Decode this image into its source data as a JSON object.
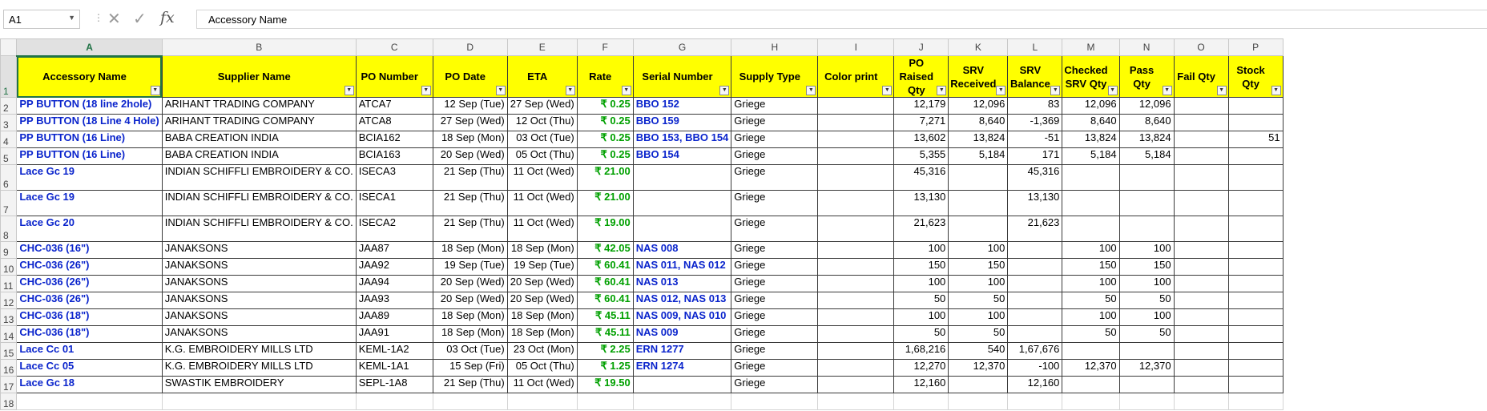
{
  "formula_bar": {
    "name_box": "A1",
    "formula": "Accessory Name",
    "cancel_icon": "✕",
    "enter_icon": "✓",
    "fx_icon": "fx"
  },
  "columns": [
    "A",
    "B",
    "C",
    "D",
    "E",
    "F",
    "G",
    "H",
    "I",
    "J",
    "K",
    "L",
    "M",
    "N",
    "O",
    "P"
  ],
  "header_row": [
    "Accessory Name",
    "Supplier Name",
    "PO Number",
    "PO Date",
    "ETA",
    "Rate",
    "Serial Number",
    "Supply Type",
    "Color print",
    "PO Raised Qty",
    "SRV Received",
    "SRV Balance",
    "Checked SRV Qty",
    "Pass Qty",
    "Fail Qty",
    "Stock Qty"
  ],
  "rows": [
    {
      "n": "2",
      "c": [
        "PP BUTTON (18 line 2hole)",
        "ARIHANT TRADING COMPANY",
        "ATCA7",
        "12 Sep (Tue)",
        "27 Sep (Wed)",
        "₹ 0.25",
        "BBO 152",
        "Griege",
        "",
        "12,179",
        "12,096",
        "83",
        "12,096",
        "12,096",
        "",
        ""
      ]
    },
    {
      "n": "3",
      "c": [
        "PP BUTTON (18 Line 4 Hole)",
        "ARIHANT TRADING COMPANY",
        "ATCA8",
        "27 Sep (Wed)",
        "12 Oct (Thu)",
        "₹ 0.25",
        "BBO 159",
        "Griege",
        "",
        "7,271",
        "8,640",
        "-1,369",
        "8,640",
        "8,640",
        "",
        ""
      ]
    },
    {
      "n": "4",
      "c": [
        "PP BUTTON (16 Line)",
        "BABA CREATION INDIA",
        "BCIA162",
        "18 Sep (Mon)",
        "03 Oct (Tue)",
        "₹ 0.25",
        "BBO 153, BBO 154",
        "Griege",
        "",
        "13,602",
        "13,824",
        "-51",
        "13,824",
        "13,824",
        "",
        "51"
      ]
    },
    {
      "n": "5",
      "c": [
        "PP BUTTON (16 Line)",
        "BABA CREATION INDIA",
        "BCIA163",
        "20 Sep (Wed)",
        "05 Oct (Thu)",
        "₹ 0.25",
        "BBO 154",
        "Griege",
        "",
        "5,355",
        "5,184",
        "171",
        "5,184",
        "5,184",
        "",
        ""
      ]
    },
    {
      "n": "6",
      "tall": true,
      "c": [
        "Lace Gc 19",
        "INDIAN SCHIFFLI EMBROIDERY & CO.",
        "ISECA3",
        "21 Sep (Thu)",
        "11 Oct (Wed)",
        "₹ 21.00",
        "",
        "Griege",
        "",
        "45,316",
        "",
        "45,316",
        "",
        "",
        "",
        ""
      ]
    },
    {
      "n": "7",
      "tall": true,
      "c": [
        "Lace Gc 19",
        "INDIAN SCHIFFLI EMBROIDERY & CO.",
        "ISECA1",
        "21 Sep (Thu)",
        "11 Oct (Wed)",
        "₹ 21.00",
        "",
        "Griege",
        "",
        "13,130",
        "",
        "13,130",
        "",
        "",
        "",
        ""
      ]
    },
    {
      "n": "8",
      "tall": true,
      "c": [
        "Lace Gc 20",
        "INDIAN SCHIFFLI EMBROIDERY & CO.",
        "ISECA2",
        "21 Sep (Thu)",
        "11 Oct (Wed)",
        "₹ 19.00",
        "",
        "Griege",
        "",
        "21,623",
        "",
        "21,623",
        "",
        "",
        "",
        ""
      ]
    },
    {
      "n": "9",
      "c": [
        "CHC-036 (16\")",
        "JANAKSONS",
        "JAA87",
        "18 Sep (Mon)",
        "18 Sep (Mon)",
        "₹ 42.05",
        "NAS 008",
        "Griege",
        "",
        "100",
        "100",
        "",
        "100",
        "100",
        "",
        ""
      ]
    },
    {
      "n": "10",
      "c": [
        "CHC-036 (26\")",
        "JANAKSONS",
        "JAA92",
        "19 Sep (Tue)",
        "19 Sep (Tue)",
        "₹ 60.41",
        "NAS 011, NAS 012",
        "Griege",
        "",
        "150",
        "150",
        "",
        "150",
        "150",
        "",
        ""
      ]
    },
    {
      "n": "11",
      "c": [
        "CHC-036 (26\")",
        "JANAKSONS",
        "JAA94",
        "20 Sep (Wed)",
        "20 Sep (Wed)",
        "₹ 60.41",
        "NAS 013",
        "Griege",
        "",
        "100",
        "100",
        "",
        "100",
        "100",
        "",
        ""
      ]
    },
    {
      "n": "12",
      "c": [
        "CHC-036 (26\")",
        "JANAKSONS",
        "JAA93",
        "20 Sep (Wed)",
        "20 Sep (Wed)",
        "₹ 60.41",
        "NAS 012, NAS 013",
        "Griege",
        "",
        "50",
        "50",
        "",
        "50",
        "50",
        "",
        ""
      ]
    },
    {
      "n": "13",
      "c": [
        "CHC-036 (18\")",
        "JANAKSONS",
        "JAA89",
        "18 Sep (Mon)",
        "18 Sep (Mon)",
        "₹ 45.11",
        "NAS 009, NAS 010",
        "Griege",
        "",
        "100",
        "100",
        "",
        "100",
        "100",
        "",
        ""
      ]
    },
    {
      "n": "14",
      "c": [
        "CHC-036 (18\")",
        "JANAKSONS",
        "JAA91",
        "18 Sep (Mon)",
        "18 Sep (Mon)",
        "₹ 45.11",
        "NAS 009",
        "Griege",
        "",
        "50",
        "50",
        "",
        "50",
        "50",
        "",
        ""
      ]
    },
    {
      "n": "15",
      "c": [
        "Lace Cc 01",
        "K.G. EMBROIDERY MILLS LTD",
        "KEML-1A2",
        "03 Oct (Tue)",
        "23 Oct (Mon)",
        "₹ 2.25",
        "ERN 1277",
        "Griege",
        "",
        "1,68,216",
        "540",
        "1,67,676",
        "",
        "",
        "",
        ""
      ]
    },
    {
      "n": "16",
      "c": [
        "Lace Cc 05",
        "K.G. EMBROIDERY MILLS LTD",
        "KEML-1A1",
        "15 Sep (Fri)",
        "05 Oct (Thu)",
        "₹ 1.25",
        "ERN 1274",
        "Griege",
        "",
        "12,270",
        "12,370",
        "-100",
        "12,370",
        "12,370",
        "",
        ""
      ]
    },
    {
      "n": "17",
      "c": [
        "Lace Gc 18",
        "SWASTIK EMBROIDERY",
        "SEPL-1A8",
        "21 Sep (Thu)",
        "11 Oct (Wed)",
        "₹ 19.50",
        "",
        "Griege",
        "",
        "12,160",
        "",
        "12,160",
        "",
        "",
        "",
        ""
      ]
    }
  ],
  "empty_rows": [
    "18"
  ],
  "colors": {
    "header_fill": "#ffff00",
    "text_blue": "#0a24cc",
    "text_green": "#00a000",
    "grid": "#d4d4d4",
    "selection": "#217346"
  }
}
